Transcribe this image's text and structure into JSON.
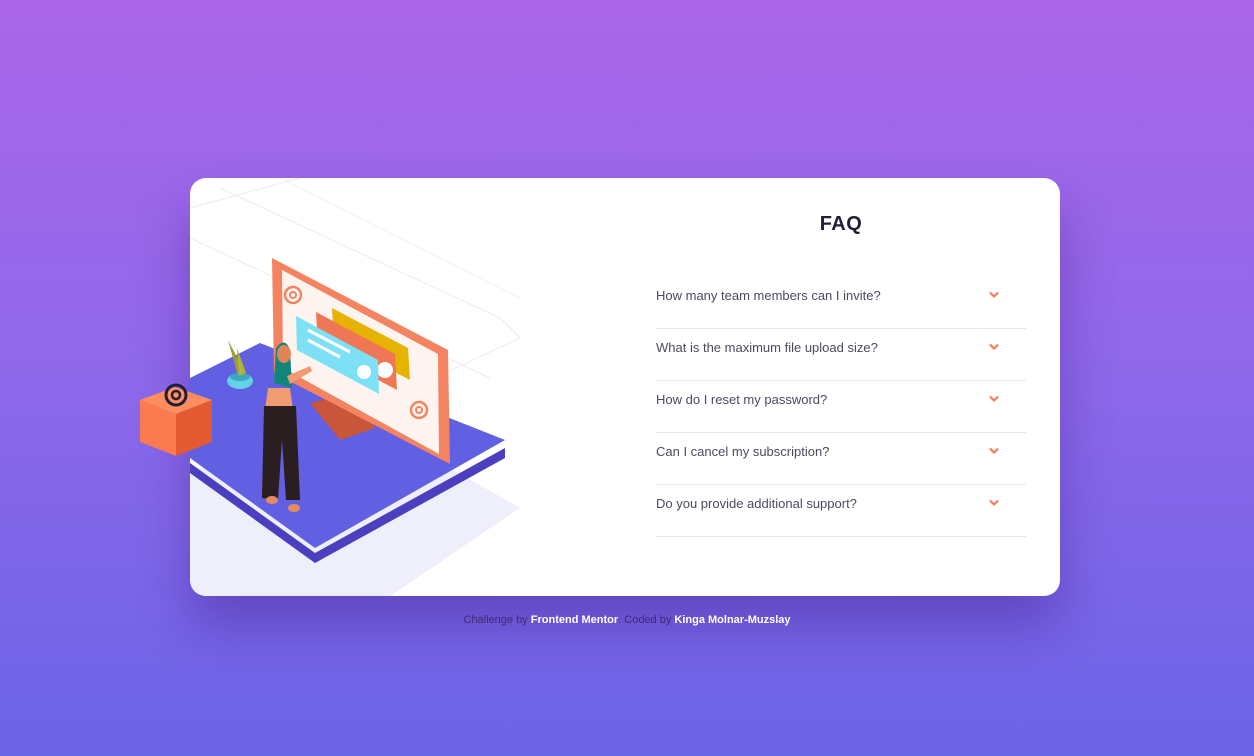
{
  "faq": {
    "title": "FAQ",
    "questions": [
      "How many team members can I invite?",
      "What is the maximum file upload size?",
      "How do I reset my password?",
      "Can I cancel my subscription?",
      "Do you provide additional support?"
    ]
  },
  "attribution": {
    "prefix": "Challenge by",
    "challenge_link": "Frontend Mentor",
    "middle": ". Coded by",
    "author_link": "Kinga Molnar-Muzslay"
  },
  "colors": {
    "background_top": "#aa66e8",
    "background_bottom": "#6b63e6",
    "card": "#ffffff",
    "title": "#1e1f36",
    "question_text": "#4a4b5e",
    "chevron": "#f47c57",
    "divider": "#e8e8ea"
  },
  "icons": {
    "chevron": "chevron-down-icon",
    "illustration": "woman-online-illustration",
    "box": "at-sign-box-illustration"
  }
}
